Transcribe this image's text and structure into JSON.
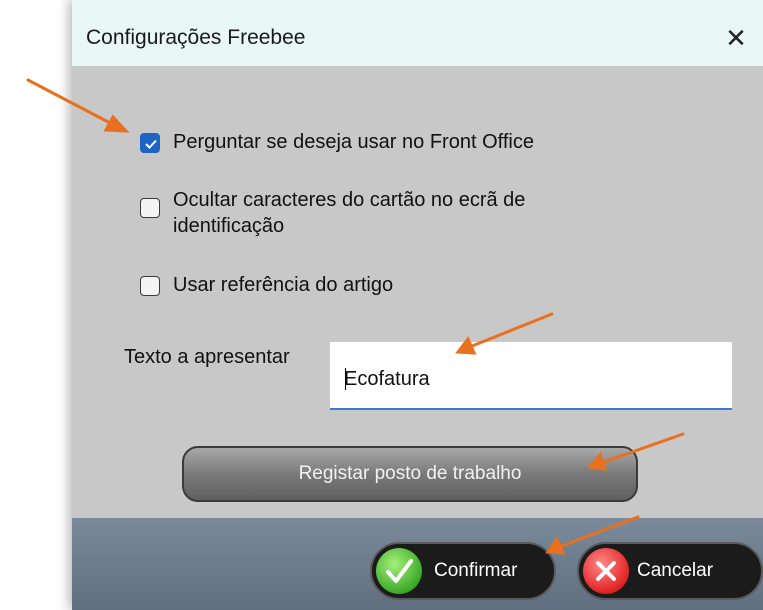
{
  "window": {
    "title": "Configurações Freebee",
    "close_glyph": "✕"
  },
  "options": [
    {
      "label": "Perguntar se deseja usar no Front Office",
      "checked": true
    },
    {
      "label_line1": "Ocultar caracteres do cartão no ecrã  de",
      "label_line2": "identificação",
      "checked": false
    },
    {
      "label": "Usar referência do artigo",
      "checked": false
    }
  ],
  "display_text": {
    "label": "Texto a apresentar",
    "value": "Ecofatura"
  },
  "register_button": {
    "label": "Registar posto de trabalho"
  },
  "footer": {
    "confirm_label": "Confirmar",
    "cancel_label": "Cancelar"
  },
  "colors": {
    "accent_checkbox": "#1f64c4",
    "annotation_arrow": "#e8701e",
    "confirm_icon": "#3caa2a",
    "cancel_icon": "#e42a2a"
  },
  "icons": [
    "close-icon",
    "checkmark-icon",
    "check-circle-icon",
    "x-circle-icon",
    "annotation-arrow-icon"
  ]
}
